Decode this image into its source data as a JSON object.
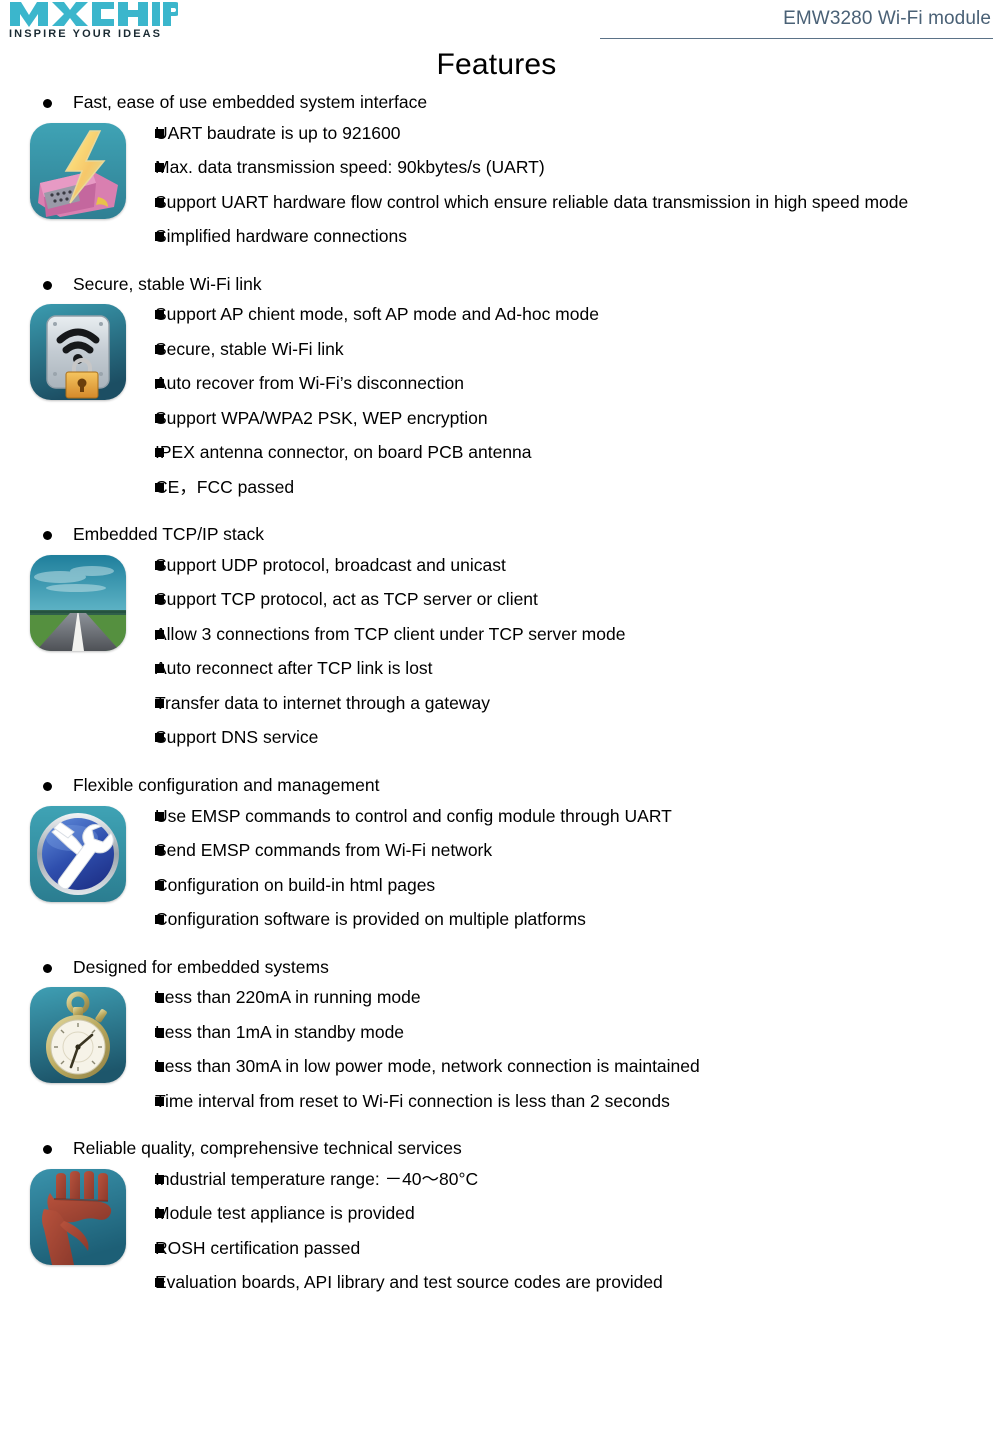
{
  "header": {
    "logo_text": "MXCHIP",
    "logo_tagline": "INSPIRE YOUR IDEAS",
    "product_title": "EMW3280 Wi-Fi module",
    "brand_color": "#3BB6CC",
    "title_color": "#4a6176"
  },
  "page": {
    "title": "Features"
  },
  "sections": [
    {
      "heading": "Fast, ease of use embedded system interface",
      "icon": "serial-port-lightning-icon",
      "items": [
        "UART baudrate is up to 921600",
        "Max. data transmission speed: 90kbytes/s (UART)",
        "Support UART hardware flow control which ensure reliable data transmission in high speed mode",
        "Simplified hardware connections"
      ]
    },
    {
      "heading": "Secure, stable Wi-Fi link",
      "icon": "wifi-lock-drive-icon",
      "items": [
        "Support AP chient mode, soft AP mode and Ad-hoc mode",
        "Secure, stable Wi-Fi link",
        "Auto recover from Wi-Fi’s disconnection",
        "Support WPA/WPA2 PSK, WEP encryption",
        "IPEX antenna connector, on board PCB antenna",
        "CE，FCC passed"
      ]
    },
    {
      "heading": "Embedded TCP/IP stack",
      "icon": "road-horizon-icon",
      "items": [
        "Support UDP protocol, broadcast and unicast",
        "Support TCP protocol, act as TCP server or client",
        "Allow 3 connections from TCP client under TCP server mode",
        "Auto reconnect after TCP link is lost",
        "Transfer data to internet through a gateway",
        "Support DNS service"
      ]
    },
    {
      "heading": "Flexible configuration and management",
      "icon": "hammer-wrench-tools-icon",
      "items": [
        "Use EMSP commands to control and config module through UART",
        "Send EMSP commands from Wi-Fi network",
        "Configuration on build-in html pages",
        "Configuration software is provided on multiple platforms"
      ]
    },
    {
      "heading": "Designed for embedded systems",
      "icon": "stopwatch-icon",
      "items": [
        "Less than 220mA in running mode",
        "Less than 1mA in standby mode",
        "Less than 30mA in low power mode, network connection is maintained",
        "Time interval from reset to Wi-Fi connection is less than 2 seconds"
      ]
    },
    {
      "heading": "Reliable quality, comprehensive technical services",
      "icon": "raised-fist-icon",
      "items": [
        "Industrial temperature range: －40～80°C",
        "Module test appliance is provided",
        "ROSH certification passed",
        "Evaluation boards, API library and test source codes are provided"
      ]
    }
  ]
}
